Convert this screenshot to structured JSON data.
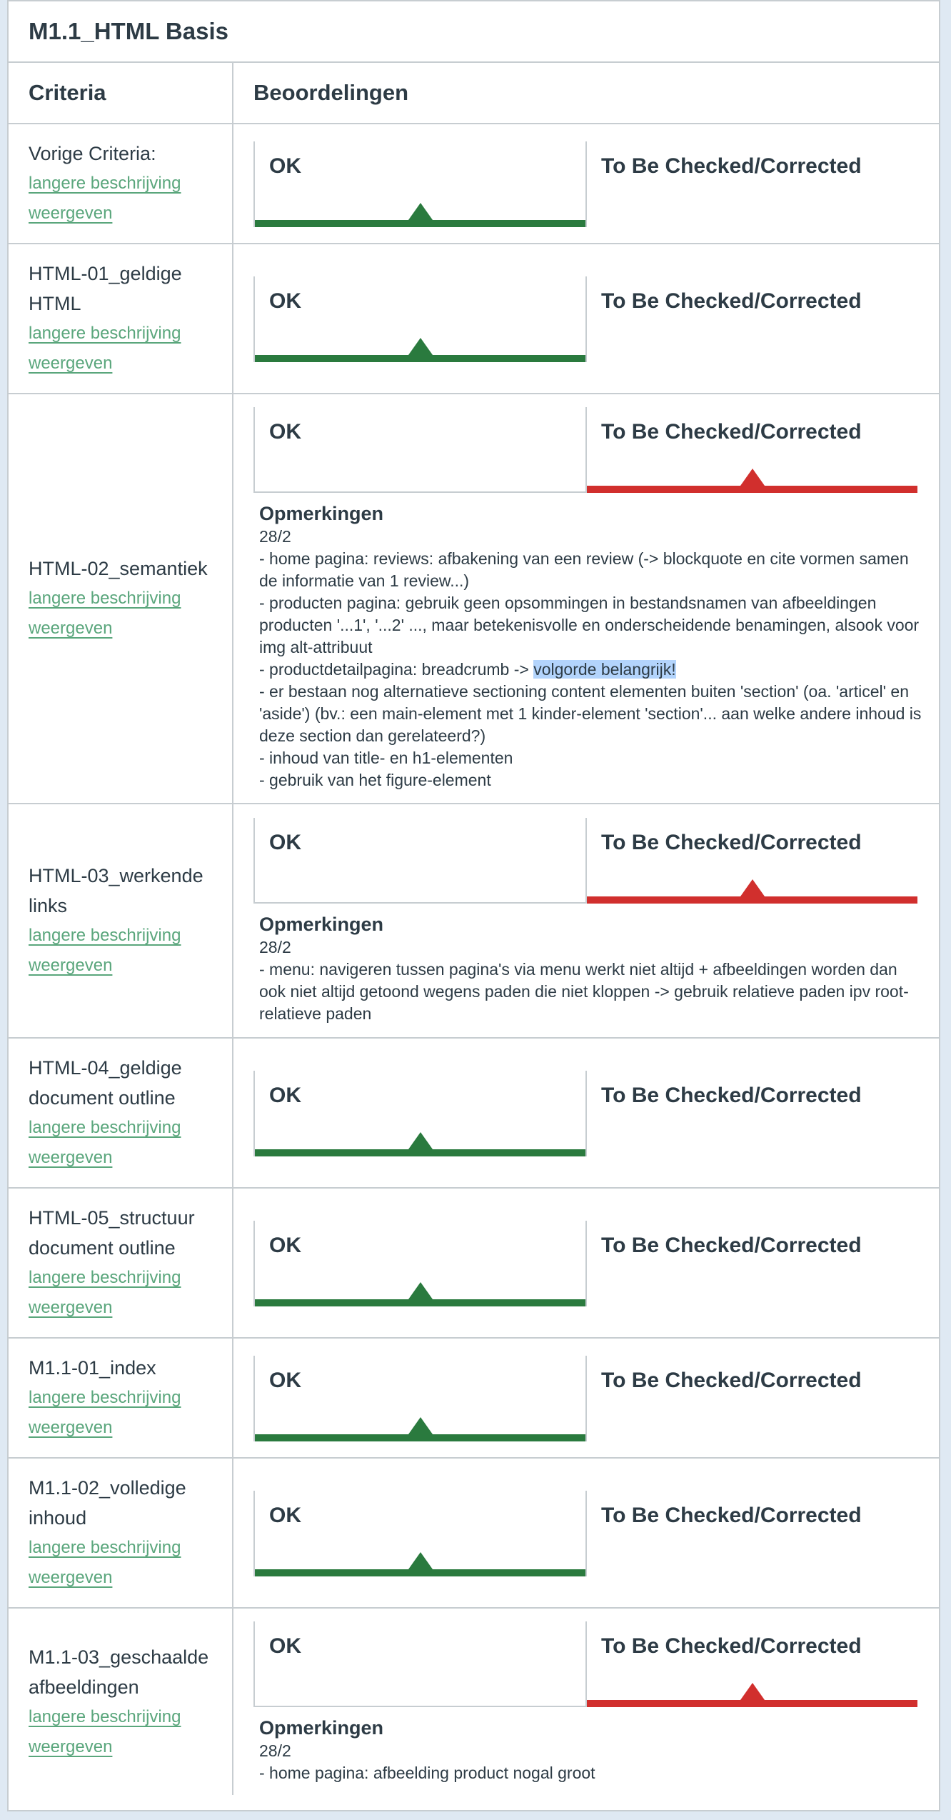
{
  "section_title": "M1.1_HTML Basis",
  "headers": {
    "criteria": "Criteria",
    "ratings": "Beoordelingen"
  },
  "rating_labels": {
    "ok": "OK",
    "check": "To Be Checked/Corrected"
  },
  "comments_title": "Opmerkingen",
  "description_link": "langere beschrijving weergeven",
  "colors": {
    "green": "#2a7a3e",
    "red": "#d12f2d",
    "link": "#5aa67c",
    "highlight": "#b3d4fc"
  },
  "rows": [
    {
      "name": "Vorige Criteria:",
      "selected": "ok",
      "comments": null
    },
    {
      "name": "HTML-01_geldige HTML",
      "selected": "ok",
      "comments": null
    },
    {
      "name": "HTML-02_semantiek",
      "selected": "check",
      "comments": {
        "date": "28/2",
        "lines": [
          "- home pagina: reviews: afbakening van een review (-> blockquote en cite vormen samen de informatie van 1 review...)",
          "- producten pagina: gebruik geen opsommingen in bestandsnamen van afbeeldingen producten '...1', '...2' ..., maar betekenisvolle en onderscheidende benamingen, alsook voor img alt-attribuut",
          "- productdetailpagina: breadcrumb -> ",
          "- er bestaan nog alternatieve sectioning content elementen buiten 'section' (oa. 'articel' en 'aside') (bv.: een main-element met 1 kinder-element 'section'... aan welke andere inhoud is deze section dan gerelateerd?)",
          "- inhoud van title- en h1-elementen",
          "- gebruik van het figure-element"
        ],
        "highlight": "volgorde belangrijk!"
      }
    },
    {
      "name": "HTML-03_werkende links",
      "selected": "check",
      "comments": {
        "date": "28/2",
        "lines": [
          "- menu: navigeren tussen pagina's via menu werkt niet altijd + afbeeldingen worden dan ook niet altijd getoond wegens paden die niet kloppen -> gebruik relatieve paden ipv root-relatieve paden"
        ]
      }
    },
    {
      "name": "HTML-04_geldige document outline",
      "selected": "ok",
      "comments": null
    },
    {
      "name": "HTML-05_structuur document outline",
      "selected": "ok",
      "comments": null
    },
    {
      "name": "M1.1-01_index",
      "selected": "ok",
      "comments": null
    },
    {
      "name": "M1.1-02_volledige inhoud",
      "selected": "ok",
      "comments": null
    },
    {
      "name": "M1.1-03_geschaalde afbeeldingen",
      "selected": "check",
      "comments": {
        "date": "28/2",
        "lines": [
          "- home pagina: afbeelding product nogal groot"
        ]
      }
    }
  ]
}
